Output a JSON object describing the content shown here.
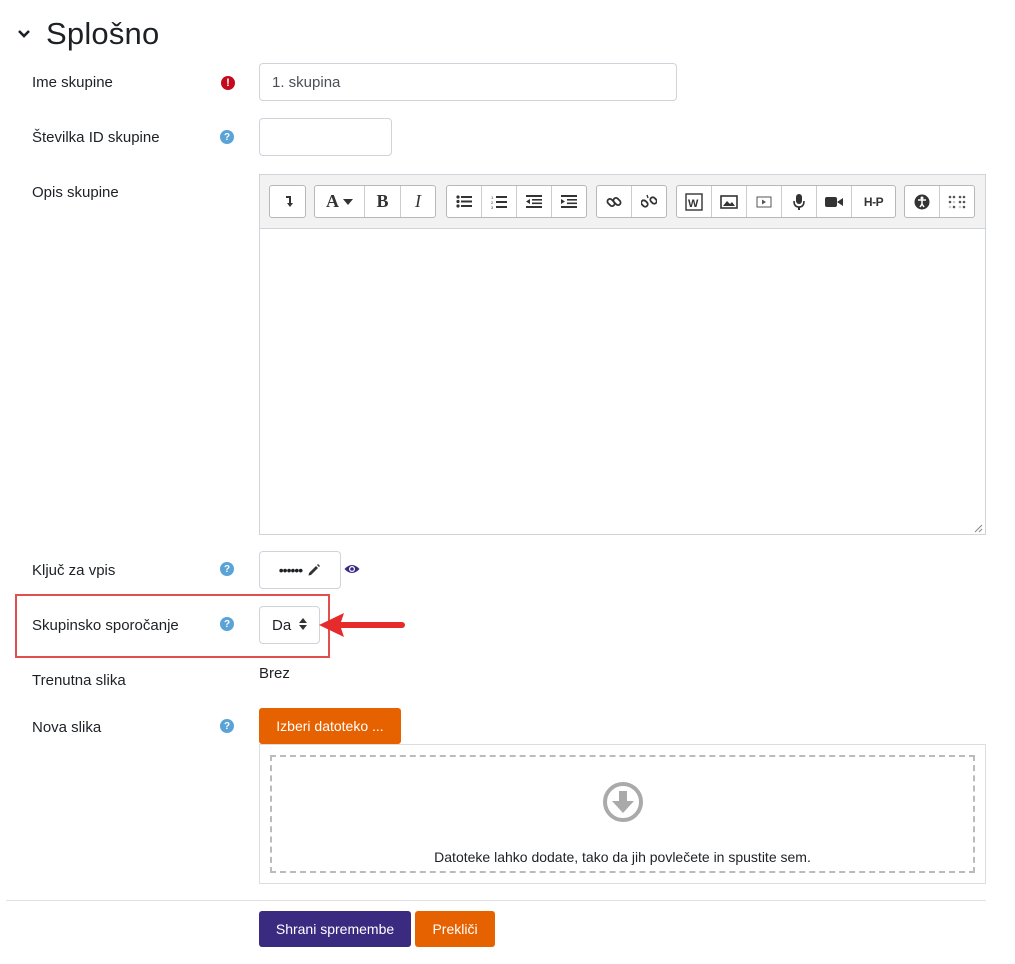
{
  "section": {
    "title": "Splošno"
  },
  "fields": {
    "name": {
      "label": "Ime skupine",
      "value": "1. skupina"
    },
    "idnumber": {
      "label": "Številka ID skupine",
      "value": ""
    },
    "description": {
      "label": "Opis skupine"
    },
    "enrolkey": {
      "label": "Ključ za vpis",
      "masked": "••••••"
    },
    "messaging": {
      "label": "Skupinsko sporočanje",
      "selected": "Da"
    },
    "currentpicture": {
      "label": "Trenutna slika",
      "value": "Brez"
    },
    "newpicture": {
      "label": "Nova slika",
      "choose_button": "Izberi datoteko ...",
      "drop_hint": "Datoteke lahko dodate, tako da jih povlečete in spustite sem."
    }
  },
  "toolbar": {
    "groups": [
      [
        "collapse-icon"
      ],
      [
        "font-color-icon",
        "bold-icon",
        "italic-icon"
      ],
      [
        "bullet-list-icon",
        "numbered-list-icon",
        "outdent-icon",
        "indent-icon"
      ],
      [
        "link-icon",
        "unlink-icon"
      ],
      [
        "word-import-icon",
        "image-icon",
        "media-icon",
        "record-audio-icon",
        "record-video-icon",
        "h5p-icon"
      ],
      [
        "accessibility-checker-icon",
        "screenreader-helper-icon"
      ]
    ],
    "bold": "B",
    "italic": "I",
    "font": "A",
    "h5p": "H-P"
  },
  "actions": {
    "save": "Shrani spremembe",
    "cancel": "Prekliči"
  },
  "colors": {
    "accent_orange": "#e66100",
    "primary_purple": "#3a2a80",
    "help_blue": "#5aa3d6",
    "required_red": "#c4091d",
    "highlight_red": "#e34f4f"
  }
}
